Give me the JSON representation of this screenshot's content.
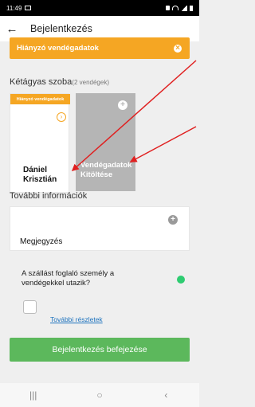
{
  "status": {
    "time": "11:49"
  },
  "header": {
    "back": "←",
    "title": "Bejelentkezés"
  },
  "banner": {
    "text": "Hiányzó vendégadatok"
  },
  "room": {
    "title": "Kétágyas szoba",
    "subtitle": "(2 vendégek)",
    "guests": [
      {
        "tag": "Hiányzó vendégadatok",
        "chevron": "›",
        "name_line1": "Dániel",
        "name_line2": "Krisztián"
      },
      {
        "label_line1": "Vendégadatok",
        "label_line2": "Kitöltése",
        "plus": "+"
      }
    ]
  },
  "more": {
    "title": "További információk",
    "notes_label": "Megjegyzés",
    "plus": "+"
  },
  "travel_question": "A szállást foglaló személy a vendégekkel utazik?",
  "details_link": "További részletek",
  "finish_button": "Bejelentkezés befejezése",
  "nav": {
    "recent": "|||",
    "home": "○",
    "back": "‹"
  },
  "colors": {
    "orange": "#f5a623",
    "green": "#5cb85c",
    "toggle_green": "#2ecc71",
    "grey_card": "#b5b5b5",
    "link_blue": "#1e73be",
    "annotation_red": "#e02020"
  }
}
